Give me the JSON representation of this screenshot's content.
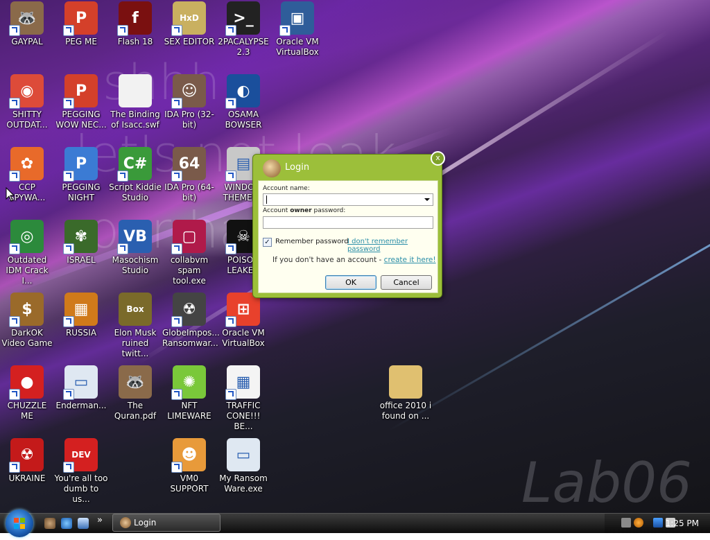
{
  "wallpaper": {
    "watermark_lines": [
      "shhh...",
      "let's not leak",
      "our ha"
    ],
    "brand": "Lab06"
  },
  "desktop_icons": [
    {
      "label": "GAYPAL",
      "icon": "raccoon-icon",
      "color": "#8a6a4a",
      "glyph": "🦝",
      "shortcut": true
    },
    {
      "label": "PEG ME",
      "icon": "p-logo-icon",
      "color": "#d4402a",
      "glyph": "P",
      "shortcut": true
    },
    {
      "label": "Flash 18",
      "icon": "flash-icon",
      "color": "#7a1010",
      "glyph": "f",
      "shortcut": true
    },
    {
      "label": "SEX EDITOR",
      "icon": "hxd-icon",
      "color": "#c9b060",
      "glyph": "HxD",
      "shortcut": true
    },
    {
      "label": "2PACALYPSE 2.3",
      "icon": "terminal-icon",
      "color": "#222222",
      "glyph": ">_",
      "shortcut": true
    },
    {
      "label": "Oracle VM VirtualBox",
      "icon": "virtualbox-icon",
      "color": "#2f5d9a",
      "glyph": "▣",
      "shortcut": true
    },
    {
      "label": "SHITTY OUTDAT...",
      "icon": "chrome-icon",
      "color": "#dd4b39",
      "glyph": "◉",
      "shortcut": true
    },
    {
      "label": "PEGGING WOW NEC...",
      "icon": "p-logo-icon",
      "color": "#d4402a",
      "glyph": "P",
      "shortcut": true
    },
    {
      "label": "The Binding of Isacc.swf",
      "icon": "file-icon",
      "color": "#f2f2f2",
      "glyph": "",
      "shortcut": false
    },
    {
      "label": "IDA Pro (32-bit)",
      "icon": "ida-icon",
      "color": "#7a5a4a",
      "glyph": "☺",
      "shortcut": true
    },
    {
      "label": "OSAMA BOWSER",
      "icon": "obama-logo-icon",
      "color": "#1a4f9c",
      "glyph": "◐",
      "shortcut": true
    },
    {
      "label": "CCP SPYWA...",
      "icon": "photos-icon",
      "color": "#e86a2a",
      "glyph": "✿",
      "shortcut": true
    },
    {
      "label": "PEGGING NIGHT",
      "icon": "p-logo-icon",
      "color": "#3b7bd4",
      "glyph": "P",
      "shortcut": true
    },
    {
      "label": "Script Kiddie Studio",
      "icon": "csharp-icon",
      "color": "#3a9a3a",
      "glyph": "C#",
      "shortcut": true
    },
    {
      "label": "IDA Pro (64-bit)",
      "icon": "ida-icon",
      "color": "#7a5a4a",
      "glyph": "64",
      "shortcut": true
    },
    {
      "label": "WINDOW THEMEP...",
      "icon": "server-icon",
      "color": "#c8c8c8",
      "glyph": "▤",
      "shortcut": true
    },
    {
      "label": "Outdated IDM Crack I...",
      "icon": "idm-icon",
      "color": "#2c8a3c",
      "glyph": "◎",
      "shortcut": true
    },
    {
      "label": "ISRAEL",
      "icon": "flower-icon",
      "color": "#3a6a2a",
      "glyph": "✾",
      "shortcut": true
    },
    {
      "label": "Masochism Studio",
      "icon": "vb-icon",
      "color": "#2a5fb0",
      "glyph": "VB",
      "shortcut": true
    },
    {
      "label": "collabvm spam tool.exe",
      "icon": "monitor-icon",
      "color": "#b01a4a",
      "glyph": "▢",
      "shortcut": true
    },
    {
      "label": "POISON LEAKED",
      "icon": "skull-icon",
      "color": "#111111",
      "glyph": "☠",
      "shortcut": true
    },
    {
      "label": "DarkOK Video Game",
      "icon": "money-bag-icon",
      "color": "#9a6a2a",
      "glyph": "$",
      "shortcut": true
    },
    {
      "label": "RUSSIA",
      "icon": "puzzle-icon",
      "color": "#d07a1a",
      "glyph": "▦",
      "shortcut": true
    },
    {
      "label": "Elon Musk ruined twitt...",
      "icon": "bonzi-box-icon",
      "color": "#7a6a2a",
      "glyph": "Box",
      "shortcut": false
    },
    {
      "label": "GlobeImpos... Ransomwar...",
      "icon": "gasmask-icon",
      "color": "#444444",
      "glyph": "☢",
      "shortcut": true
    },
    {
      "label": "Oracle VM VirtualBox",
      "icon": "windows-flag-icon",
      "color": "#e8412c",
      "glyph": "⊞",
      "shortcut": true
    },
    {
      "label": "CHUZZLE ME",
      "icon": "chuzzle-icon",
      "color": "#d42020",
      "glyph": "●",
      "shortcut": true
    },
    {
      "label": "Enderman...",
      "icon": "window-icon",
      "color": "#dfe8f2",
      "glyph": "▭",
      "shortcut": true
    },
    {
      "label": "The Quran.pdf",
      "icon": "raccoon-icon",
      "color": "#8a6a4a",
      "glyph": "🦝",
      "shortcut": false
    },
    {
      "label": "NFT LIMEWARE",
      "icon": "limewire-icon",
      "color": "#7ac83a",
      "glyph": "✺",
      "shortcut": true
    },
    {
      "label": "TRAFFIC CONE!!! BE...",
      "icon": "calendar-file-icon",
      "color": "#f4f4f4",
      "glyph": "▦",
      "shortcut": true
    },
    {
      "label": "UKRAINE",
      "icon": "radiation-icon",
      "color": "#c41a1a",
      "glyph": "☢",
      "shortcut": true
    },
    {
      "label": "You're all too dumb to us...",
      "icon": "devcpp-icon",
      "color": "#d42020",
      "glyph": "DEV",
      "shortcut": true
    },
    {
      "label": "VM0 SUPPORT",
      "icon": "support-person-icon",
      "color": "#e89a3a",
      "glyph": "☻",
      "shortcut": true
    },
    {
      "label": "My Ransom Ware.exe",
      "icon": "window-icon",
      "color": "#dfe8f2",
      "glyph": "▭",
      "shortcut": false
    },
    {
      "label": "office 2010 i found on ...",
      "icon": "folder-icon",
      "color": "#e0c070",
      "glyph": "",
      "shortcut": false
    }
  ],
  "login_dialog": {
    "title": "Login",
    "account_name_label": "Account name:",
    "account_name_value": "",
    "password_label_prefix": "Account ",
    "password_label_bold": "owner",
    "password_label_suffix": " password:",
    "password_value": "",
    "remember_label": "Remember password",
    "remember_checked": true,
    "forgot_link": "I don't remember password",
    "create_prefix": "If you don't have an account - ",
    "create_link": "create it here!",
    "ok_label": "OK",
    "cancel_label": "Cancel",
    "close_glyph": "x"
  },
  "taskbar": {
    "quick_launch": [
      "raccoon-icon",
      "ie-icon",
      "show-desktop-icon"
    ],
    "overflow": "»",
    "task_label": "Login",
    "clock": "1:25 PM"
  }
}
